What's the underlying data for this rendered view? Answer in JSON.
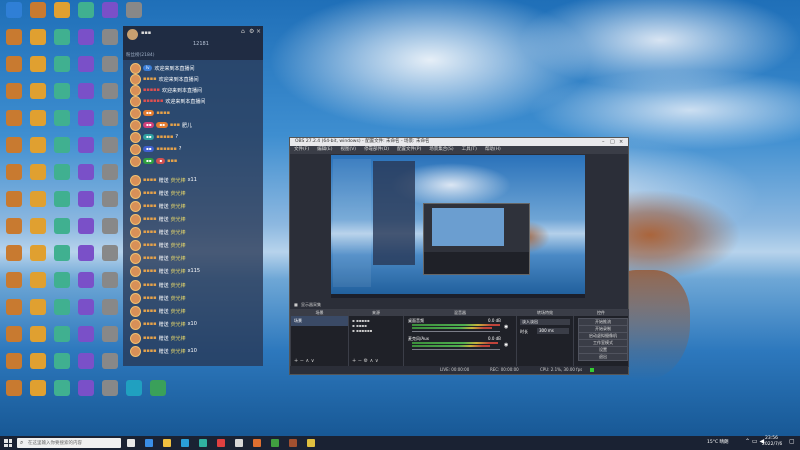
{
  "colors": {
    "sky_top": "#1f6fb8",
    "chat_bg": "#28375580",
    "obs_bg": "#2b2e38",
    "chat_username": "#e6a24a",
    "taskbar": "#1a2233"
  },
  "chat": {
    "header_users": "12181",
    "rank_label": "粉丝榜(2184)",
    "welcome_text": "欢迎来到本直播间",
    "gift_verb": "赠送",
    "gift_name": "荧光棒",
    "gift_count_11": "x11",
    "gift_count_115": "x115",
    "gift_count_10": "x10",
    "short_reply": "肥儿"
  },
  "obs": {
    "title": "OBS 27.2.4 (64-bit, windows) - 配置文件: 未命名 - 场景: 未命名",
    "menu": [
      "文件(F)",
      "编辑(E)",
      "视图(V)",
      "停靠部件(D)",
      "配置文件(P)",
      "场景集合(S)",
      "工具(T)",
      "帮助(H)"
    ],
    "scenebar_label": "显示器采集",
    "docks": [
      "场景",
      "来源",
      "混音器",
      "转场特效",
      "控件"
    ],
    "scene_item": "场景",
    "mixer": [
      {
        "name": "桌面音频",
        "db": "0.0 dB"
      },
      {
        "name": "麦克风/Aux",
        "db": "0.0 dB"
      }
    ],
    "transition": {
      "type": "淡入淡出",
      "duration_label": "时长",
      "duration": "300 ms"
    },
    "controls": [
      "开始推流",
      "开始录制",
      "启动虚拟摄像机",
      "工作室模式",
      "设置",
      "退出"
    ],
    "status": {
      "live": "LIVE: 00:00:00",
      "rec": "REC: 00:00:00",
      "cpu": "CPU: 2.1%, 30.00 fps"
    }
  },
  "taskbar": {
    "search_placeholder": "在这里输入你要搜索的内容",
    "weather": "15°C 晴朗",
    "time": "23:56",
    "date": "2022/7/6"
  }
}
